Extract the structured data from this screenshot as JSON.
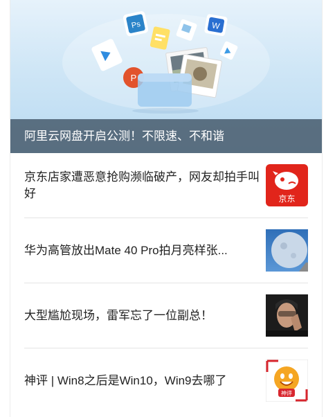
{
  "hero": {
    "caption": "阿里云网盘开启公测！不限速、不和谐",
    "icon_labels": {
      "ps": "Ps",
      "word": "W",
      "ppt": "P"
    }
  },
  "articles": [
    {
      "title": "京东店家遭恶意抢购濒临破产，网友却拍手叫好",
      "thumb_icon": "jd-logo-icon",
      "thumb_text": "京东"
    },
    {
      "title": "华为高管放出Mate 40 Pro拍月亮样张...",
      "thumb_icon": "moon-photo-icon"
    },
    {
      "title": "大型尴尬现场，雷军忘了一位副总！",
      "thumb_icon": "person-photo-icon"
    },
    {
      "title": "神评 | Win8之后是Win10，Win9去哪了",
      "thumb_icon": "smiley-logo-icon",
      "thumb_text": "神评"
    }
  ],
  "colors": {
    "caption_bg": "#485c6e",
    "jd_red": "#e1251b",
    "divider": "#e4e4e4"
  }
}
